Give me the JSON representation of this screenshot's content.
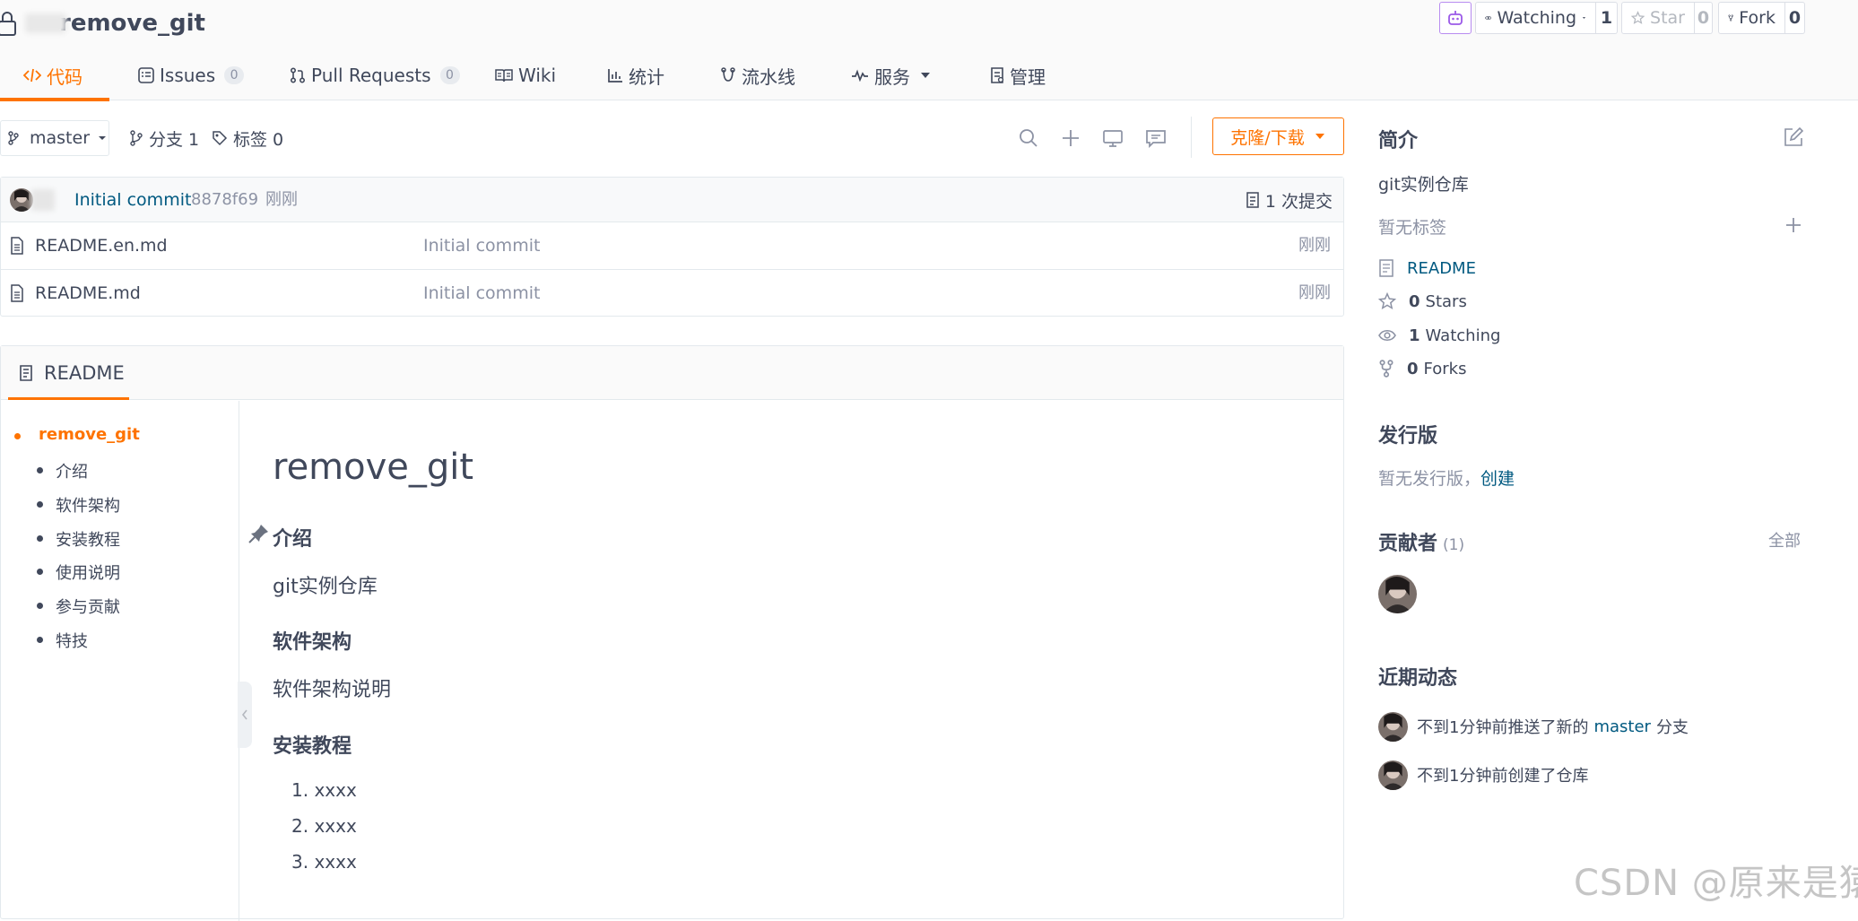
{
  "repo": {
    "name": "remove_git"
  },
  "actions": {
    "watch": {
      "label": "Watching",
      "count": "1"
    },
    "star": {
      "label": "Star",
      "count": "0"
    },
    "fork": {
      "label": "Fork",
      "count": "0"
    }
  },
  "tabs": [
    {
      "label": "代码"
    },
    {
      "label": "Issues",
      "badge": "0"
    },
    {
      "label": "Pull Requests",
      "badge": "0"
    },
    {
      "label": "Wiki"
    },
    {
      "label": "统计"
    },
    {
      "label": "流水线"
    },
    {
      "label": "服务"
    },
    {
      "label": "管理"
    }
  ],
  "branch": {
    "current": "master",
    "branches_label": "分支 1",
    "tags_label": "标签 0"
  },
  "clone_label": "克隆/下载",
  "commit": {
    "message": "Initial commit",
    "hash": "8878f69",
    "time": "刚刚",
    "count_label": "1 次提交"
  },
  "files": [
    {
      "name": "README.en.md",
      "commit": "Initial commit",
      "time": "刚刚"
    },
    {
      "name": "README.md",
      "commit": "Initial commit",
      "time": "刚刚"
    }
  ],
  "readme": {
    "tab_label": "README",
    "toc": [
      "remove_git",
      "介绍",
      "软件架构",
      "安装教程",
      "使用说明",
      "参与贡献",
      "特技"
    ],
    "title": "remove_git",
    "sections": {
      "intro_h": "介绍",
      "intro_p": "git实例仓库",
      "arch_h": "软件架构",
      "arch_p": "软件架构说明",
      "install_h": "安装教程"
    },
    "install_list": [
      "1.  xxxx",
      "2.  xxxx",
      "3.  xxxx"
    ]
  },
  "sidebar": {
    "intro_title": "简介",
    "description": "git实例仓库",
    "no_tags": "暂无标签",
    "readme_link": "README",
    "stars": {
      "count": "0",
      "label": "Stars"
    },
    "watching": {
      "count": "1",
      "label": "Watching"
    },
    "forks": {
      "count": "0",
      "label": "Forks"
    },
    "releases_title": "发行版",
    "no_release": "暂无发行版，",
    "create_link": "创建",
    "contributors_title": "贡献者",
    "contributors_count": "(1)",
    "all_link": "全部",
    "activity_title": "近期动态",
    "activity": {
      "push_prefix": "不到1分钟前推送了新的",
      "push_branch": "master",
      "push_suffix": "分支",
      "create": "不到1分钟前创建了仓库"
    }
  },
  "watermark": "CSDN @原来是猿",
  "colors": {
    "accent": "#fe7300",
    "link": "#005980",
    "text": "#40485b",
    "muted": "#8c92a4",
    "border": "#e3e9ed"
  }
}
